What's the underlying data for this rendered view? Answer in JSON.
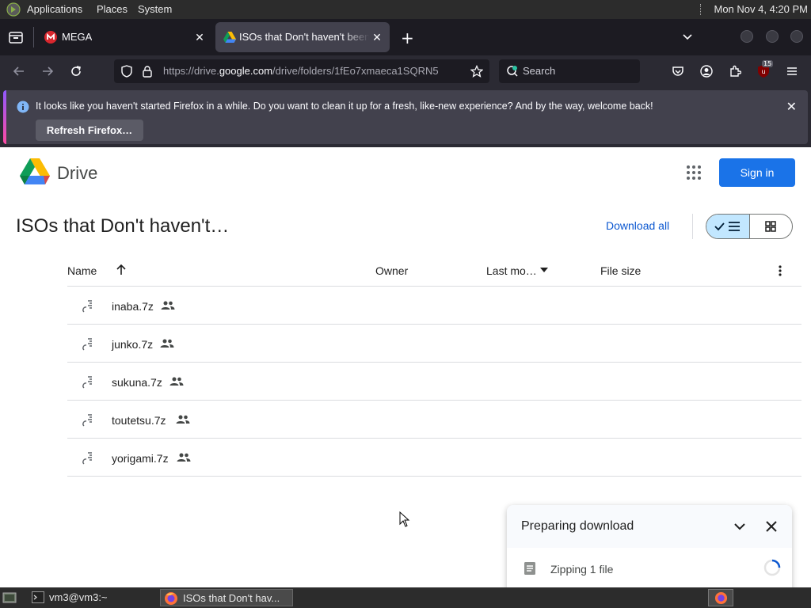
{
  "top_panel": {
    "menus": [
      "Applications",
      "Places",
      "System"
    ],
    "clock": "Mon Nov  4,  4:20 PM"
  },
  "browser": {
    "tabs": [
      {
        "title": "MEGA",
        "active": false
      },
      {
        "title": "ISOs that Don't haven't been",
        "active": true
      }
    ],
    "url_prefix": "https://drive.",
    "url_domain": "google.com",
    "url_rest": "/drive/folders/1fEo7xmaeca1SQRN5",
    "search_placeholder": "Search",
    "extension_badge": "15"
  },
  "notification": {
    "message": "It looks like you haven't started Firefox in a while. Do you want to clean it up for a fresh, like-new experience? And by the way, welcome back!",
    "button_label": "Refresh Firefox…"
  },
  "drive": {
    "app_name": "Drive",
    "sign_in_label": "Sign in",
    "folder_title": "ISOs that Don't haven't…",
    "download_all_label": "Download all",
    "columns": {
      "name": "Name",
      "owner": "Owner",
      "modified": "Last mo…",
      "size": "File size"
    },
    "files": [
      {
        "name": "inaba.7z"
      },
      {
        "name": "junko.7z"
      },
      {
        "name": "sukuna.7z"
      },
      {
        "name": "toutetsu.7z"
      },
      {
        "name": "yorigami.7z"
      }
    ],
    "download_panel": {
      "title": "Preparing download",
      "item": "Zipping 1 file"
    }
  },
  "taskbar": {
    "items": [
      {
        "label": "vm3@vm3:~"
      },
      {
        "label": "ISOs that Don't hav..."
      }
    ]
  }
}
